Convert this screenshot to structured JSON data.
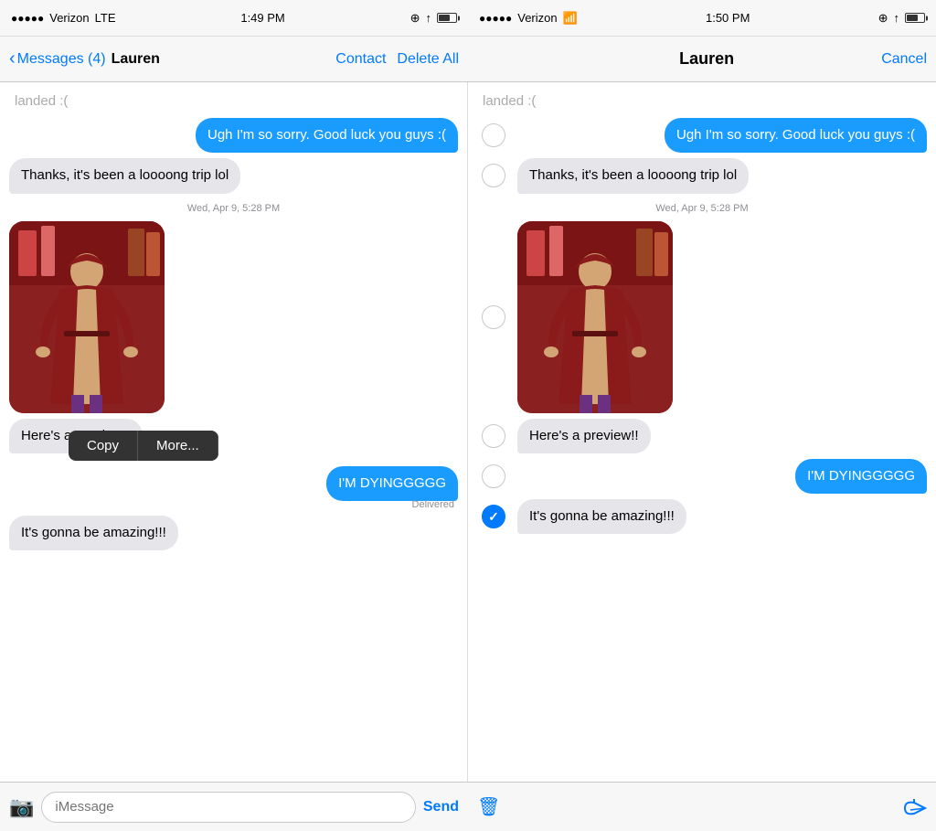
{
  "statusBar": {
    "left": {
      "carrier": "Verizon",
      "network": "LTE",
      "time": "1:49 PM"
    },
    "right": {
      "carrier": "Verizon",
      "network": "WiFi",
      "time": "1:50 PM"
    }
  },
  "navBar": {
    "left": {
      "backLabel": "Messages (4)",
      "contactName": "Lauren",
      "contactBtn": "Contact",
      "deleteBtn": "Delete All"
    },
    "right": {
      "title": "Lauren",
      "cancelBtn": "Cancel"
    }
  },
  "panel1": {
    "truncated": "landed :(",
    "messages": [
      {
        "type": "sent",
        "text": "Ugh I'm so sorry. Good luck you guys :("
      },
      {
        "type": "received",
        "text": "Thanks, it's been a loooong trip lol"
      },
      {
        "timestamp": "Wed, Apr 9, 5:28 PM"
      },
      {
        "type": "image"
      },
      {
        "type": "received",
        "text": "Here's a preview!!"
      },
      {
        "type": "sent",
        "text": "I'M DYINGGGGG",
        "hasContextMenu": true
      },
      {
        "type": "received",
        "text": "It's gonna be amazing!!!"
      }
    ],
    "contextMenu": {
      "copyLabel": "Copy",
      "moreLabel": "More..."
    },
    "delivered": "Delivered"
  },
  "panel2": {
    "truncated": "landed :(",
    "messages": [
      {
        "type": "sent",
        "text": "Ugh I'm so sorry. Good luck you guys :(",
        "selected": false
      },
      {
        "type": "received",
        "text": "Thanks, it's been a loooong trip lol",
        "selected": false
      },
      {
        "timestamp": "Wed, Apr 9, 5:28 PM"
      },
      {
        "type": "image",
        "selected": false
      },
      {
        "type": "received",
        "text": "Here's a preview!!",
        "selected": false
      },
      {
        "type": "sent",
        "text": "I'M DYINGGGGG",
        "selected": false
      },
      {
        "type": "received",
        "text": "It's gonna be amazing!!!",
        "selected": true
      }
    ]
  },
  "inputBar": {
    "placeholder": "iMessage",
    "sendLabel": "Send"
  }
}
